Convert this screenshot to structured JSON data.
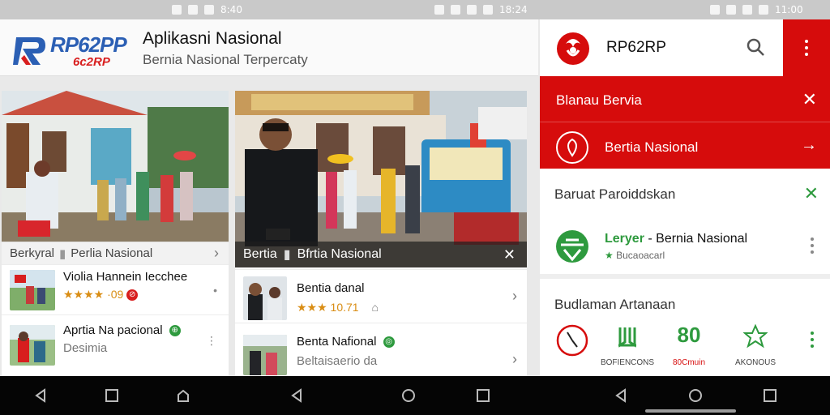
{
  "status_bar": {
    "left_time": "8:40",
    "mid_time": "18:24",
    "right_time": "11:00"
  },
  "header": {
    "logo_text": "RP62PP",
    "logo_sub": "6c2RP",
    "title": "Aplikasni Nasional",
    "subtitle": "Bernia Nasional Terpercaty"
  },
  "left_card": {
    "section_label": "Berkyral",
    "section_title": "Perlia Nasional",
    "rows": [
      {
        "title": "Violia Hannein Iecchee",
        "rating": "★★★★ ·09",
        "rating_badge": "⊘"
      },
      {
        "title": "Aprtia Na pacional",
        "subtitle": "Desimia",
        "title_badge": "⊕"
      }
    ]
  },
  "mid_card": {
    "overlay_label": "Bertia",
    "overlay_title": "Bfrtia Nasional",
    "rows": [
      {
        "title": "Bentia danal",
        "rating": "★★★ 10.71"
      },
      {
        "title": "Benta Nafional",
        "subtitle": "Beltaisaerio da",
        "title_badge": "◎"
      }
    ]
  },
  "right_panel": {
    "app_title": "RP62RP",
    "red_block": {
      "title": "Blanau Bervia",
      "item_label": "Bertia Nasional"
    },
    "section1": {
      "title": "Baruat Paroiddskan",
      "line1_green": "Leryer",
      "line1_rest": " - Bernia Nasional",
      "line2": "Bucaoacarl"
    },
    "section2": {
      "title": "Budlaman Artanaan",
      "tools": [
        {
          "label": ""
        },
        {
          "label": "BOFIENCONS"
        },
        {
          "label": "80Cmuin"
        },
        {
          "label": "AKONOUS"
        }
      ],
      "tool_value": "80"
    }
  },
  "colors": {
    "brand_red": "#d60c0c",
    "brand_blue": "#2b5fb4",
    "accent_green": "#2e9a3e",
    "rating_orange": "#d98d14"
  },
  "icons": {
    "search": "search-icon",
    "menu": "more-vert-icon",
    "close": "close-icon",
    "chevron": "chevron-right-icon",
    "star": "star-icon"
  }
}
